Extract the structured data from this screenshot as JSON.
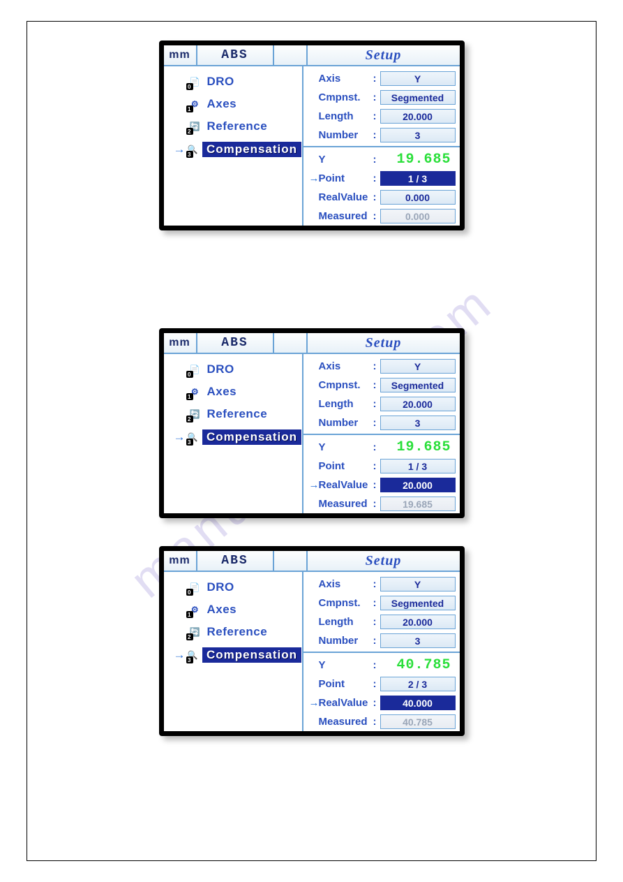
{
  "watermark": "manualshive.com",
  "tabs": {
    "mm": "mm",
    "abs": "ABS",
    "setup": "Setup"
  },
  "menu": {
    "items": [
      {
        "badge": "0",
        "label": "DRO"
      },
      {
        "badge": "1",
        "label": "Axes"
      },
      {
        "badge": "2",
        "label": "Reference"
      },
      {
        "badge": "3",
        "label": "Compensation"
      }
    ]
  },
  "labels": {
    "axis": "Axis",
    "cmpnst": "Cmpnst.",
    "length": "Length",
    "number": "Number",
    "y": "Y",
    "point": "Point",
    "realvalue": "RealValue",
    "measured": "Measured"
  },
  "panels": [
    {
      "axis": "Y",
      "cmpnst": "Segmented",
      "length": "20.000",
      "number": "3",
      "yreadout": "19.685",
      "point": "1 /    3",
      "realvalue": "0.000",
      "measured": "0.000",
      "activeField": "point"
    },
    {
      "axis": "Y",
      "cmpnst": "Segmented",
      "length": "20.000",
      "number": "3",
      "yreadout": "19.685",
      "point": "1 /    3",
      "realvalue": "20.000",
      "measured": "19.685",
      "activeField": "realvalue"
    },
    {
      "axis": "Y",
      "cmpnst": "Segmented",
      "length": "20.000",
      "number": "3",
      "yreadout": "40.785",
      "point": "2 /    3",
      "realvalue": "40.000",
      "measured": "40.785",
      "activeField": "realvalue"
    }
  ]
}
